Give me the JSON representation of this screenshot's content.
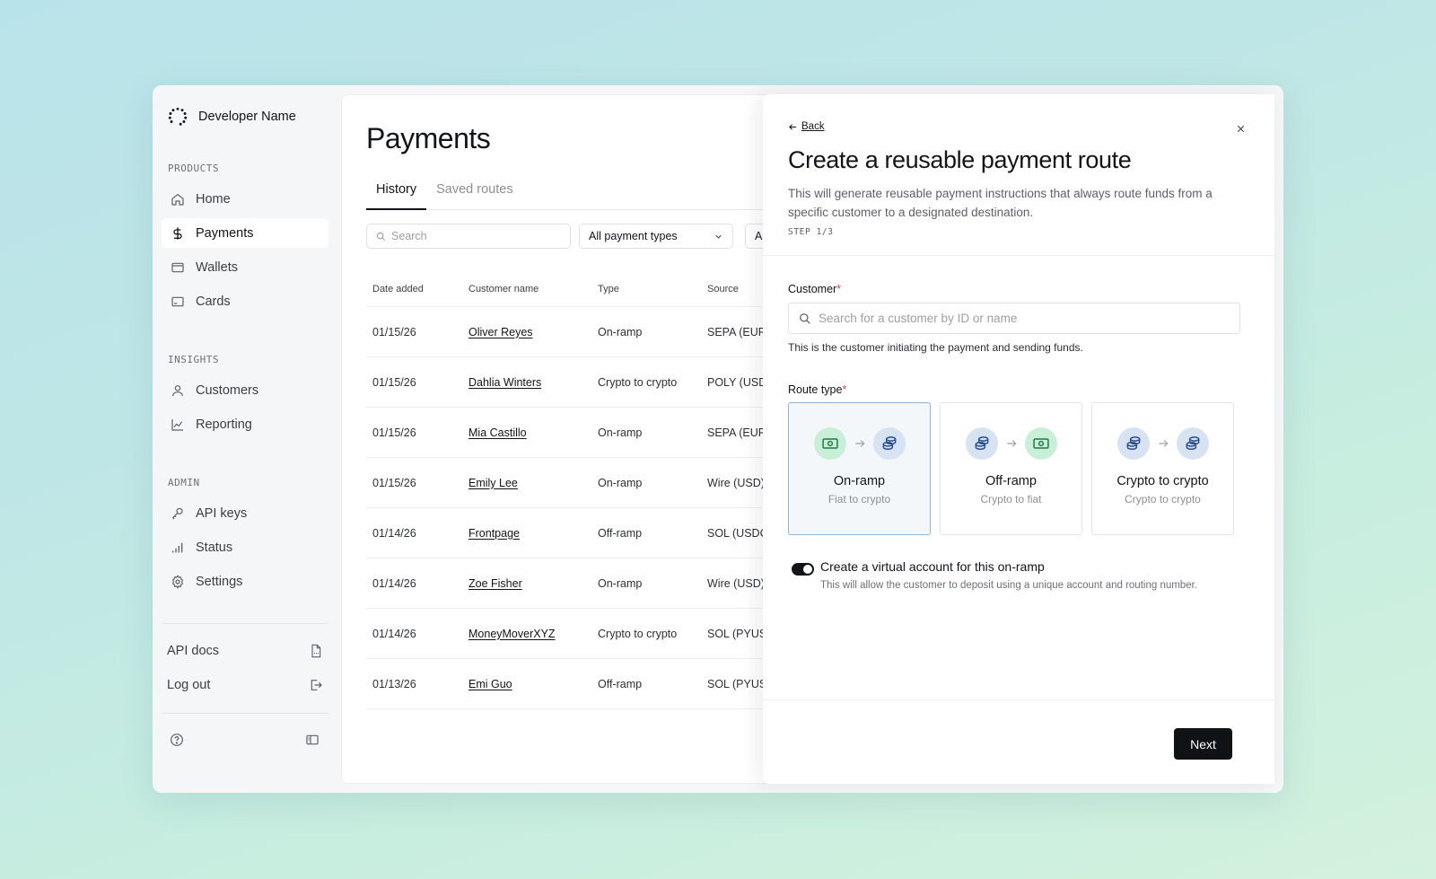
{
  "brand": {
    "name": "Developer Name"
  },
  "sidebar": {
    "sections": [
      {
        "label": "PRODUCTS",
        "items": [
          {
            "label": "Home",
            "icon": "home-icon"
          },
          {
            "label": "Payments",
            "icon": "dollar-icon",
            "active": true
          },
          {
            "label": "Wallets",
            "icon": "wallet-icon"
          },
          {
            "label": "Cards",
            "icon": "card-icon"
          }
        ]
      },
      {
        "label": "INSIGHTS",
        "items": [
          {
            "label": "Customers",
            "icon": "user-icon"
          },
          {
            "label": "Reporting",
            "icon": "chart-line-icon"
          }
        ]
      },
      {
        "label": "ADMIN",
        "items": [
          {
            "label": "API keys",
            "icon": "key-icon"
          },
          {
            "label": "Status",
            "icon": "signal-bars-icon"
          },
          {
            "label": "Settings",
            "icon": "gear-icon"
          }
        ]
      }
    ],
    "footer": [
      {
        "label": "API docs",
        "icon": "doc-file-icon"
      },
      {
        "label": "Log out",
        "icon": "logout-icon"
      }
    ]
  },
  "main": {
    "title": "Payments",
    "tabs": [
      {
        "label": "History",
        "active": true
      },
      {
        "label": "Saved routes"
      }
    ],
    "search": {
      "placeholder": "Search"
    },
    "filters": [
      {
        "label": "All payment types"
      },
      {
        "label": "Al"
      }
    ],
    "table": {
      "columns": [
        "Date added",
        "Customer name",
        "Type",
        "Source"
      ],
      "rows": [
        [
          "01/15/26",
          "Oliver Reyes",
          "On-ramp",
          "SEPA (EUR)"
        ],
        [
          "01/15/26",
          "Dahlia Winters",
          "Crypto to crypto",
          "POLY (USDC"
        ],
        [
          "01/15/26",
          "Mia Castillo",
          "On-ramp",
          "SEPA (EUR)"
        ],
        [
          "01/15/26",
          "Emily Lee",
          "On-ramp",
          "Wire (USD)"
        ],
        [
          "01/14/26",
          "Frontpage",
          "Off-ramp",
          "SOL (USDC"
        ],
        [
          "01/14/26",
          "Zoe Fisher",
          "On-ramp",
          "Wire (USD)"
        ],
        [
          "01/14/26",
          "MoneyMoverXYZ",
          "Crypto to crypto",
          "SOL (PYUSD"
        ],
        [
          "01/13/26",
          "Emi Guo",
          "Off-ramp",
          "SOL (PYUSD"
        ]
      ]
    }
  },
  "drawer": {
    "back_label": "Back",
    "title": "Create a reusable payment route",
    "description": "This will generate reusable payment instructions that always route funds from a specific customer to a designated destination.",
    "step": "STEP 1/3",
    "customer": {
      "label": "Customer",
      "required_mark": "*",
      "placeholder": "Search for a customer by ID or name",
      "helper": "This is the customer initiating the payment and sending funds."
    },
    "route_type": {
      "label": "Route type",
      "required_mark": "*",
      "options": [
        {
          "title": "On-ramp",
          "subtitle": "Fiat to crypto",
          "from": "cash-icon",
          "to": "coins-icon",
          "selected": true
        },
        {
          "title": "Off-ramp",
          "subtitle": "Crypto to fiat",
          "from": "coins-icon",
          "to": "cash-icon"
        },
        {
          "title": "Crypto to crypto",
          "subtitle": "Crypto to crypto",
          "from": "coins-icon",
          "to": "coins-icon"
        }
      ]
    },
    "virtual_account": {
      "enabled": true,
      "label": "Create a virtual account for this on-ramp",
      "help": "This will allow the customer to deposit using a unique account and routing number."
    },
    "next_label": "Next"
  },
  "colors": {
    "primary": "#0f1316",
    "required": "#d64545",
    "selected_border": "#8fb6d8",
    "cash_bg": "#c9efd9",
    "coins_bg": "#d7e3f3"
  }
}
